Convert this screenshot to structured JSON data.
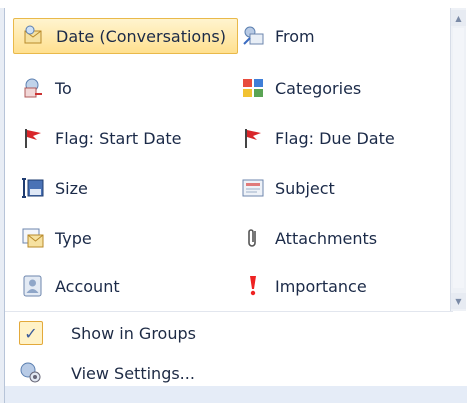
{
  "arrange_menu": {
    "items": [
      {
        "label": "Date (Conversations)",
        "icon": "date-conversations-icon",
        "selected": true
      },
      {
        "label": "From",
        "icon": "from-icon"
      },
      {
        "label": "To",
        "icon": "to-icon"
      },
      {
        "label": "Categories",
        "icon": "categories-icon"
      },
      {
        "label": "Flag: Start Date",
        "icon": "flag-start-icon"
      },
      {
        "label": "Flag: Due Date",
        "icon": "flag-due-icon"
      },
      {
        "label": "Size",
        "icon": "size-icon"
      },
      {
        "label": "Subject",
        "icon": "subject-icon"
      },
      {
        "label": "Type",
        "icon": "type-icon"
      },
      {
        "label": "Attachments",
        "icon": "attachment-icon"
      },
      {
        "label": "Account",
        "icon": "account-icon"
      },
      {
        "label": "Importance",
        "icon": "importance-icon"
      }
    ],
    "bottom": {
      "show_in_groups": "Show in Groups",
      "show_in_groups_checked": true,
      "view_settings": "View Settings..."
    }
  }
}
